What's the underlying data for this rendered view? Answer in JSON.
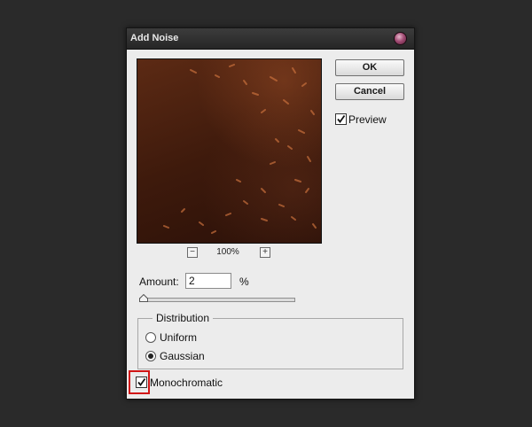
{
  "dialog": {
    "title": "Add Noise"
  },
  "preview": {
    "zoom_level": "100%",
    "zoom_out_symbol": "−",
    "zoom_in_symbol": "+"
  },
  "buttons": {
    "ok_label": "OK",
    "cancel_label": "Cancel"
  },
  "preview_option": {
    "label": "Preview",
    "checked": true
  },
  "amount": {
    "label": "Amount:",
    "value": "2",
    "unit": "%",
    "slider_fraction": 0.0
  },
  "distribution": {
    "title": "Distribution",
    "options": [
      {
        "label": "Uniform",
        "selected": false
      },
      {
        "label": "Gaussian",
        "selected": true
      }
    ]
  },
  "monochromatic": {
    "label": "Monochromatic",
    "checked": true
  },
  "colors": {
    "highlight": "#d11515",
    "dialog_bg": "#ececec",
    "desktop_bg": "#2a2a2a"
  }
}
